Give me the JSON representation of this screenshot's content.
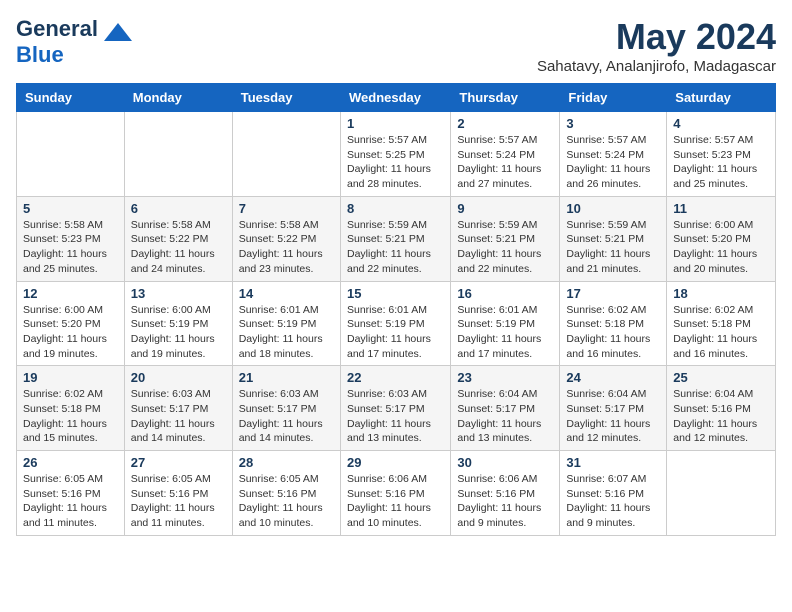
{
  "header": {
    "logo_line1": "General",
    "logo_line2": "Blue",
    "month": "May 2024",
    "location": "Sahatavy, Analanjirofo, Madagascar"
  },
  "weekdays": [
    "Sunday",
    "Monday",
    "Tuesday",
    "Wednesday",
    "Thursday",
    "Friday",
    "Saturday"
  ],
  "weeks": [
    [
      {
        "day": "",
        "info": ""
      },
      {
        "day": "",
        "info": ""
      },
      {
        "day": "",
        "info": ""
      },
      {
        "day": "1",
        "info": "Sunrise: 5:57 AM\nSunset: 5:25 PM\nDaylight: 11 hours\nand 28 minutes."
      },
      {
        "day": "2",
        "info": "Sunrise: 5:57 AM\nSunset: 5:24 PM\nDaylight: 11 hours\nand 27 minutes."
      },
      {
        "day": "3",
        "info": "Sunrise: 5:57 AM\nSunset: 5:24 PM\nDaylight: 11 hours\nand 26 minutes."
      },
      {
        "day": "4",
        "info": "Sunrise: 5:57 AM\nSunset: 5:23 PM\nDaylight: 11 hours\nand 25 minutes."
      }
    ],
    [
      {
        "day": "5",
        "info": "Sunrise: 5:58 AM\nSunset: 5:23 PM\nDaylight: 11 hours\nand 25 minutes."
      },
      {
        "day": "6",
        "info": "Sunrise: 5:58 AM\nSunset: 5:22 PM\nDaylight: 11 hours\nand 24 minutes."
      },
      {
        "day": "7",
        "info": "Sunrise: 5:58 AM\nSunset: 5:22 PM\nDaylight: 11 hours\nand 23 minutes."
      },
      {
        "day": "8",
        "info": "Sunrise: 5:59 AM\nSunset: 5:21 PM\nDaylight: 11 hours\nand 22 minutes."
      },
      {
        "day": "9",
        "info": "Sunrise: 5:59 AM\nSunset: 5:21 PM\nDaylight: 11 hours\nand 22 minutes."
      },
      {
        "day": "10",
        "info": "Sunrise: 5:59 AM\nSunset: 5:21 PM\nDaylight: 11 hours\nand 21 minutes."
      },
      {
        "day": "11",
        "info": "Sunrise: 6:00 AM\nSunset: 5:20 PM\nDaylight: 11 hours\nand 20 minutes."
      }
    ],
    [
      {
        "day": "12",
        "info": "Sunrise: 6:00 AM\nSunset: 5:20 PM\nDaylight: 11 hours\nand 19 minutes."
      },
      {
        "day": "13",
        "info": "Sunrise: 6:00 AM\nSunset: 5:19 PM\nDaylight: 11 hours\nand 19 minutes."
      },
      {
        "day": "14",
        "info": "Sunrise: 6:01 AM\nSunset: 5:19 PM\nDaylight: 11 hours\nand 18 minutes."
      },
      {
        "day": "15",
        "info": "Sunrise: 6:01 AM\nSunset: 5:19 PM\nDaylight: 11 hours\nand 17 minutes."
      },
      {
        "day": "16",
        "info": "Sunrise: 6:01 AM\nSunset: 5:19 PM\nDaylight: 11 hours\nand 17 minutes."
      },
      {
        "day": "17",
        "info": "Sunrise: 6:02 AM\nSunset: 5:18 PM\nDaylight: 11 hours\nand 16 minutes."
      },
      {
        "day": "18",
        "info": "Sunrise: 6:02 AM\nSunset: 5:18 PM\nDaylight: 11 hours\nand 16 minutes."
      }
    ],
    [
      {
        "day": "19",
        "info": "Sunrise: 6:02 AM\nSunset: 5:18 PM\nDaylight: 11 hours\nand 15 minutes."
      },
      {
        "day": "20",
        "info": "Sunrise: 6:03 AM\nSunset: 5:17 PM\nDaylight: 11 hours\nand 14 minutes."
      },
      {
        "day": "21",
        "info": "Sunrise: 6:03 AM\nSunset: 5:17 PM\nDaylight: 11 hours\nand 14 minutes."
      },
      {
        "day": "22",
        "info": "Sunrise: 6:03 AM\nSunset: 5:17 PM\nDaylight: 11 hours\nand 13 minutes."
      },
      {
        "day": "23",
        "info": "Sunrise: 6:04 AM\nSunset: 5:17 PM\nDaylight: 11 hours\nand 13 minutes."
      },
      {
        "day": "24",
        "info": "Sunrise: 6:04 AM\nSunset: 5:17 PM\nDaylight: 11 hours\nand 12 minutes."
      },
      {
        "day": "25",
        "info": "Sunrise: 6:04 AM\nSunset: 5:16 PM\nDaylight: 11 hours\nand 12 minutes."
      }
    ],
    [
      {
        "day": "26",
        "info": "Sunrise: 6:05 AM\nSunset: 5:16 PM\nDaylight: 11 hours\nand 11 minutes."
      },
      {
        "day": "27",
        "info": "Sunrise: 6:05 AM\nSunset: 5:16 PM\nDaylight: 11 hours\nand 11 minutes."
      },
      {
        "day": "28",
        "info": "Sunrise: 6:05 AM\nSunset: 5:16 PM\nDaylight: 11 hours\nand 10 minutes."
      },
      {
        "day": "29",
        "info": "Sunrise: 6:06 AM\nSunset: 5:16 PM\nDaylight: 11 hours\nand 10 minutes."
      },
      {
        "day": "30",
        "info": "Sunrise: 6:06 AM\nSunset: 5:16 PM\nDaylight: 11 hours\nand 9 minutes."
      },
      {
        "day": "31",
        "info": "Sunrise: 6:07 AM\nSunset: 5:16 PM\nDaylight: 11 hours\nand 9 minutes."
      },
      {
        "day": "",
        "info": ""
      }
    ]
  ]
}
